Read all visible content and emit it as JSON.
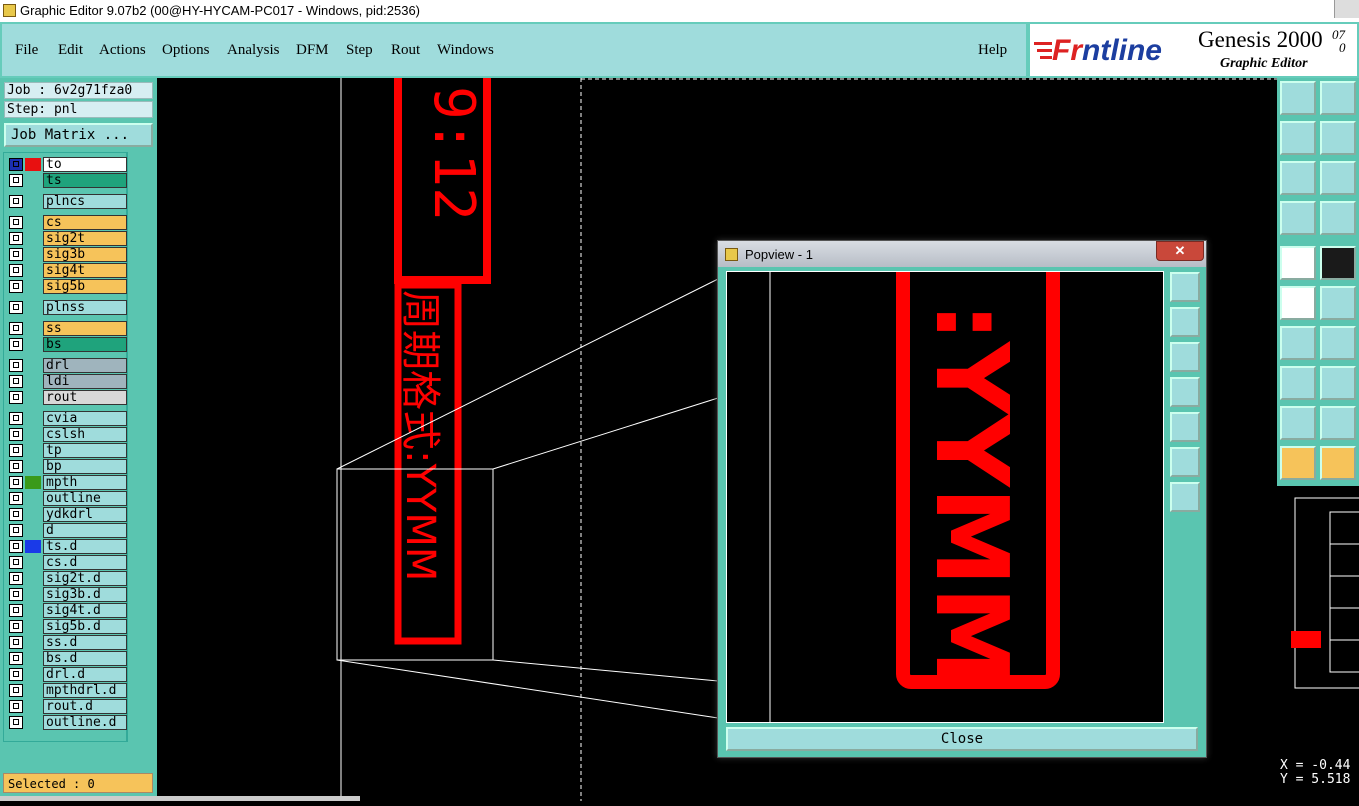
{
  "window": {
    "title": "Graphic Editor 9.07b2 (00@HY-HYCAM-PC017 - Windows, pid:2536)"
  },
  "menu": {
    "items": [
      {
        "label": "File"
      },
      {
        "label": "Edit"
      },
      {
        "label": "Actions"
      },
      {
        "label": "Options"
      },
      {
        "label": "Analysis"
      },
      {
        "label": "DFM"
      },
      {
        "label": "Step"
      },
      {
        "label": "Rout"
      },
      {
        "label": "Windows"
      }
    ],
    "help": "Help"
  },
  "brand": {
    "logo_prefix": "Fr",
    "logo_rest": "ntline",
    "product": "Genesis 2000",
    "version_top": "07",
    "version_bottom": "0",
    "subtitle": "Graphic Editor"
  },
  "job": {
    "job_line": "Job : 6v2g71fza0",
    "step_line": "Step: pnl",
    "matrix_button": "Job Matrix ..."
  },
  "layers": [
    {
      "name": "to",
      "color": "#ffffff",
      "swatch": "#e81010",
      "swatch2": "#1b2fb0"
    },
    {
      "name": "ts",
      "color": "#1fa37c",
      "swatch": ""
    },
    {
      "name": "plncs",
      "color": "#9fdcdc",
      "swatch": ""
    },
    {
      "name": "cs",
      "color": "#f6c35a",
      "swatch": ""
    },
    {
      "name": "sig2t",
      "color": "#f6c35a",
      "swatch": ""
    },
    {
      "name": "sig3b",
      "color": "#f6c35a",
      "swatch": ""
    },
    {
      "name": "sig4t",
      "color": "#f6c35a",
      "swatch": ""
    },
    {
      "name": "sig5b",
      "color": "#f6c35a",
      "swatch": ""
    },
    {
      "name": "plnss",
      "color": "#9fdcdc",
      "swatch": ""
    },
    {
      "name": "ss",
      "color": "#f6c35a",
      "swatch": ""
    },
    {
      "name": "bs",
      "color": "#1fa37c",
      "swatch": ""
    },
    {
      "name": "drl",
      "color": "#9fb4bd",
      "swatch": ""
    },
    {
      "name": "ldi",
      "color": "#9fb4bd",
      "swatch": ""
    },
    {
      "name": "rout",
      "color": "#d8d8d8",
      "swatch": ""
    },
    {
      "name": "cvia",
      "color": "#9fdcdc",
      "swatch": ""
    },
    {
      "name": "cslsh",
      "color": "#9fdcdc",
      "swatch": ""
    },
    {
      "name": "tp",
      "color": "#9fdcdc",
      "swatch": ""
    },
    {
      "name": "bp",
      "color": "#9fdcdc",
      "swatch": ""
    },
    {
      "name": "mpth",
      "color": "#9fdcdc",
      "swatch": "#3a9a1a"
    },
    {
      "name": "outline",
      "color": "#9fdcdc",
      "swatch": ""
    },
    {
      "name": "ydkdrl",
      "color": "#9fdcdc",
      "swatch": ""
    },
    {
      "name": "d",
      "color": "#9fdcdc",
      "swatch": ""
    },
    {
      "name": "ts.d",
      "color": "#9fdcdc",
      "swatch": "#1a3ae8"
    },
    {
      "name": "cs.d",
      "color": "#9fdcdc",
      "swatch": ""
    },
    {
      "name": "sig2t.d",
      "color": "#9fdcdc",
      "swatch": ""
    },
    {
      "name": "sig3b.d",
      "color": "#9fdcdc",
      "swatch": ""
    },
    {
      "name": "sig4t.d",
      "color": "#9fdcdc",
      "swatch": ""
    },
    {
      "name": "sig5b.d",
      "color": "#9fdcdc",
      "swatch": ""
    },
    {
      "name": "ss.d",
      "color": "#9fdcdc",
      "swatch": ""
    },
    {
      "name": "bs.d",
      "color": "#9fdcdc",
      "swatch": ""
    },
    {
      "name": "drl.d",
      "color": "#9fdcdc",
      "swatch": ""
    },
    {
      "name": "mpthdrl.d",
      "color": "#9fdcdc",
      "swatch": ""
    },
    {
      "name": "rout.d",
      "color": "#9fdcdc",
      "swatch": ""
    },
    {
      "name": "outline.d",
      "color": "#9fdcdc",
      "swatch": ""
    }
  ],
  "status": {
    "selected": "Selected : 0",
    "x": "X = -0.44",
    "y": "Y = 5.518"
  },
  "canvas": {
    "time_text": "9:12",
    "chinese_text": "周期格式:YYMM"
  },
  "popview": {
    "title": "Popview - 1",
    "close_x": "✕",
    "close_button": "Close",
    "zoom_text": ":YYMM"
  }
}
